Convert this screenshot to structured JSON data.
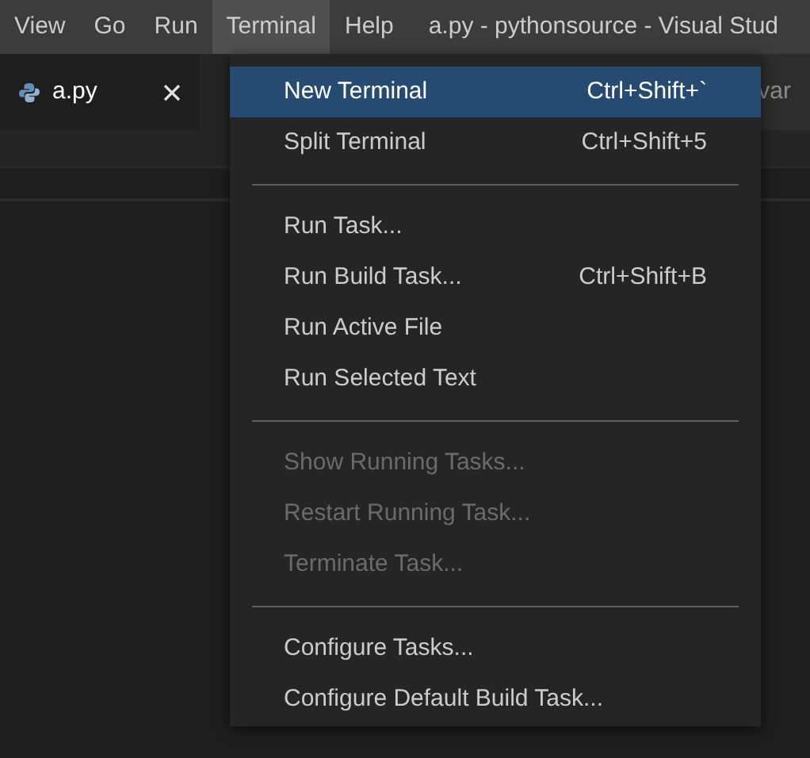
{
  "menubar": {
    "items": [
      {
        "label": "View",
        "selected": false
      },
      {
        "label": "Go",
        "selected": false
      },
      {
        "label": "Run",
        "selected": false
      },
      {
        "label": "Terminal",
        "selected": true
      },
      {
        "label": "Help",
        "selected": false
      }
    ],
    "title": "a.py - pythonsource - Visual Stud"
  },
  "tabs": [
    {
      "label": "a.py",
      "selected": true
    },
    {
      "label": "var",
      "selected": false
    }
  ],
  "menu": {
    "groups": [
      [
        {
          "label": "New Terminal",
          "shortcut": "Ctrl+Shift+`",
          "selected": true,
          "disabled": false
        },
        {
          "label": "Split Terminal",
          "shortcut": "Ctrl+Shift+5",
          "selected": false,
          "disabled": false
        }
      ],
      [
        {
          "label": "Run Task...",
          "selected": false,
          "disabled": false
        },
        {
          "label": "Run Build Task...",
          "shortcut": "Ctrl+Shift+B",
          "selected": false,
          "disabled": false
        },
        {
          "label": "Run Active File",
          "selected": false,
          "disabled": false
        },
        {
          "label": "Run Selected Text",
          "selected": false,
          "disabled": false
        }
      ],
      [
        {
          "label": "Show Running Tasks...",
          "selected": false,
          "disabled": true
        },
        {
          "label": "Restart Running Task...",
          "selected": false,
          "disabled": true
        },
        {
          "label": "Terminate Task...",
          "selected": false,
          "disabled": true
        }
      ],
      [
        {
          "label": "Configure Tasks...",
          "selected": false,
          "disabled": false
        },
        {
          "label": "Configure Default Build Task...",
          "selected": false,
          "disabled": false
        }
      ]
    ]
  }
}
